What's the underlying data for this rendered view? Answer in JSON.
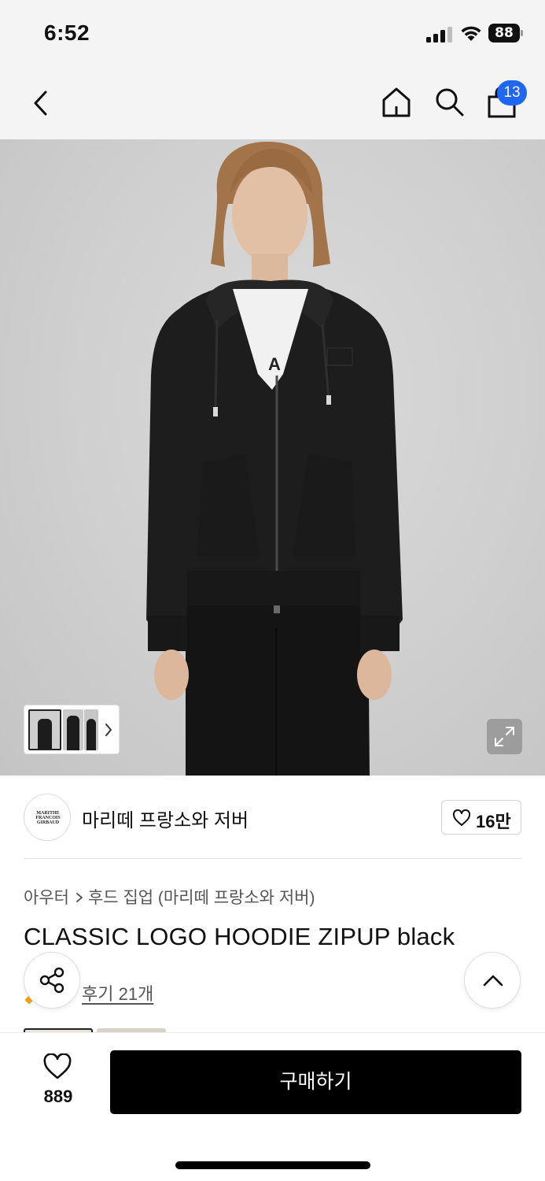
{
  "status_bar": {
    "time": "6:52",
    "battery": "88"
  },
  "nav": {
    "back_icon": "chevron-left-icon",
    "home_icon": "home-icon",
    "search_icon": "search-icon",
    "cart_icon": "shopping-bag-icon",
    "cart_count": "13",
    "badge_color": "#1f66f2"
  },
  "gallery": {
    "thumbnail_count_visible": 3,
    "next_icon": "chevron-right-icon",
    "expand_icon": "expand-icon"
  },
  "brand": {
    "logo_text": "MARITHE FRANCOIS GIRBAUD",
    "name": "마리떼 프랑소와 저버",
    "like_icon": "heart-outline-icon",
    "like_count": "16만"
  },
  "product": {
    "breadcrumb": [
      "아우터",
      "후드 집업 (마리떼 프랑소와 저버)"
    ],
    "title": "CLASSIC LOGO HOODIE ZIPUP black",
    "review_link": "후기 21개"
  },
  "floating": {
    "share_icon": "share-icon",
    "scroll_top_icon": "chevron-up-icon"
  },
  "bottom_bar": {
    "wish_icon": "heart-outline-icon",
    "wish_count": "889",
    "buy_label": "구매하기",
    "buy_color": "#000000"
  }
}
